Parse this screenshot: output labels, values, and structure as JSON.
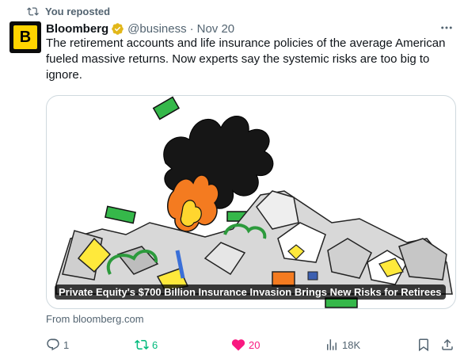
{
  "repost": {
    "label": "You reposted"
  },
  "author": {
    "avatar_letter": "B",
    "name": "Bloomberg",
    "handle": "@business",
    "separator": "·",
    "date": "Nov 20"
  },
  "tweet": {
    "text": "The retirement accounts and life insurance policies of the average American fueled massive returns. Now experts say the systemic risks are too big to ignore."
  },
  "card": {
    "title": "Private Equity's $700 Billion Insurance Invasion Brings New Risks for Retirees",
    "source": "From bloomberg.com"
  },
  "actions": {
    "replies": "1",
    "reposts": "6",
    "likes": "20",
    "views": "18K"
  },
  "colors": {
    "accent_repost": "#00ba7c",
    "accent_like": "#f91880",
    "verified_gold": "#e2b719",
    "brand_yellow": "#ffd400",
    "muted_text": "#536471"
  },
  "icons": [
    "repost-icon",
    "verified-badge-icon",
    "more-icon",
    "reply-icon",
    "heart-icon",
    "views-icon",
    "bookmark-icon",
    "share-icon"
  ]
}
